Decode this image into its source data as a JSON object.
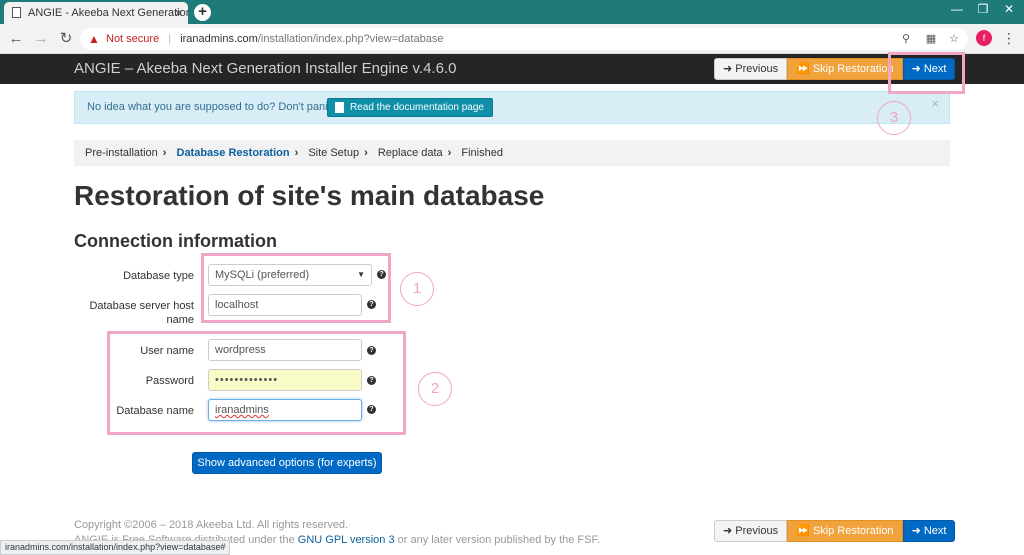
{
  "browser": {
    "tab_title": "ANGIE - Akeeba Next Generation",
    "tab_close": "×",
    "new_tab": "+",
    "security_label": "Not secure",
    "url_host": "iranadmins.com",
    "url_path": "/installation/index.php?view=database",
    "profile_initial": "f",
    "status_url": "iranadmins.com/installation/index.php?view=database#"
  },
  "header": {
    "title": "ANGIE – Akeeba Next Generation Installer Engine v.4.6.0",
    "previous_label": "Previous",
    "skip_label": "Skip Restoration",
    "next_label": "Next"
  },
  "alert": {
    "text": "No idea what you are supposed to do? Don't panic!",
    "doc_button": "Read the documentation page",
    "close": "×"
  },
  "breadcrumb": {
    "steps": [
      "Pre-installation",
      "Database Restoration",
      "Site Setup",
      "Replace data",
      "Finished"
    ]
  },
  "page": {
    "title": "Restoration of site's main database",
    "section_title": "Connection information"
  },
  "form": {
    "db_type_label": "Database type",
    "db_type_value": "MySQLi (preferred)",
    "host_label_line1": "Database server host",
    "host_label_line2": "name",
    "host_value": "localhost",
    "user_label": "User name",
    "user_value": "wordpress",
    "password_label": "Password",
    "password_value": "•••••••••••••",
    "dbname_label": "Database name",
    "dbname_value": "iranadmins",
    "advanced_button": "Show advanced options (for experts)"
  },
  "annotations": {
    "one": "1",
    "two": "2",
    "three": "3"
  },
  "footer": {
    "copyright": "Copyright ©2006 – 2018 Akeeba Ltd. All rights reserved.",
    "license_prefix": "ANGIE is Free Software distributed under the",
    "license_link": "GNU GPL version 3",
    "license_suffix": "or any later version published by the FSF."
  },
  "colors": {
    "tabbar": "#1f7a7a",
    "appbar": "#252525",
    "primary": "#0069c4",
    "warning": "#f0a33c",
    "annotation_pink": "#f0a6c6"
  },
  "icons": [
    "page-icon",
    "close-icon",
    "back-arrow-icon",
    "forward-arrow-icon",
    "reload-icon",
    "warning-icon",
    "key-icon",
    "translate-icon",
    "star-icon",
    "menu-icon",
    "arrow-left-icon",
    "fast-forward-icon",
    "arrow-right-icon",
    "document-icon",
    "question-icon",
    "caret-down-icon"
  ]
}
